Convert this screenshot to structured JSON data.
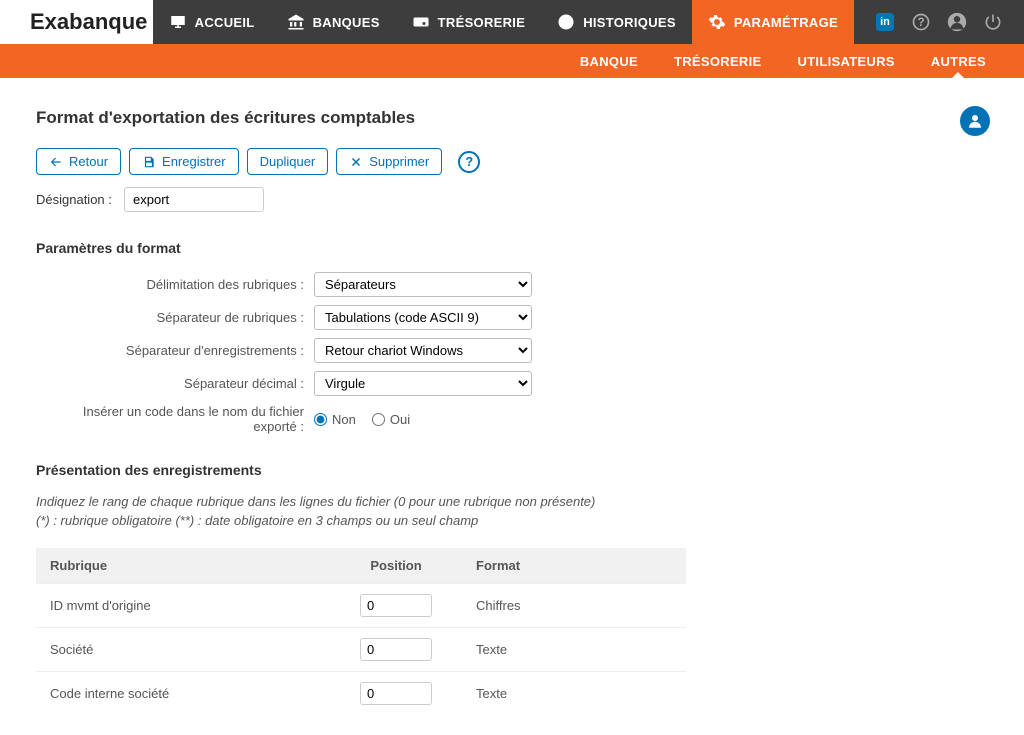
{
  "brand": {
    "full": "Exabanque",
    "bold_part": "Exa",
    "rest": "banque"
  },
  "nav": {
    "items": [
      {
        "label": "ACCUEIL",
        "icon": "monitor"
      },
      {
        "label": "BANQUES",
        "icon": "bank"
      },
      {
        "label": "TRÉSORERIE",
        "icon": "wallet"
      },
      {
        "label": "HISTORIQUES",
        "icon": "clock"
      },
      {
        "label": "PARAMÉTRAGE",
        "icon": "gear",
        "active": true
      }
    ]
  },
  "subnav": {
    "items": [
      {
        "label": "BANQUE"
      },
      {
        "label": "TRÉSORERIE"
      },
      {
        "label": "UTILISATEURS"
      },
      {
        "label": "AUTRES",
        "active": true
      }
    ]
  },
  "page": {
    "title": "Format d'exportation des écritures comptables",
    "actions": {
      "retour": "Retour",
      "enregistrer": "Enregistrer",
      "dupliquer": "Dupliquer",
      "supprimer": "Supprimer"
    },
    "designation_label": "Désignation :",
    "designation_value": "export"
  },
  "params": {
    "section_title": "Paramètres du format",
    "rows": {
      "delimitation": {
        "label": "Délimitation des rubriques :",
        "value": "Séparateurs"
      },
      "sep_rubriques": {
        "label": "Séparateur de rubriques :",
        "value": "Tabulations (code ASCII 9)"
      },
      "sep_enreg": {
        "label": "Séparateur d'enregistrements :",
        "value": "Retour chariot Windows"
      },
      "sep_decimal": {
        "label": "Séparateur décimal :",
        "value": "Virgule"
      },
      "insert_code": {
        "label": "Insérer un code dans le nom du fichier exporté :",
        "non": "Non",
        "oui": "Oui",
        "selected": "Non"
      }
    }
  },
  "presentation": {
    "section_title": "Présentation des enregistrements",
    "hint1": "Indiquez le rang de chaque rubrique dans les lignes du fichier (0 pour une rubrique non présente)",
    "hint2": "(*) : rubrique obligatoire (**) : date obligatoire en 3 champs ou un seul champ",
    "headers": {
      "rubrique": "Rubrique",
      "position": "Position",
      "format": "Format"
    },
    "rows": [
      {
        "rubrique": "ID mvmt d'origine",
        "position": "0",
        "format": "Chiffres"
      },
      {
        "rubrique": "Société",
        "position": "0",
        "format": "Texte"
      },
      {
        "rubrique": "Code interne société",
        "position": "0",
        "format": "Texte"
      }
    ]
  }
}
